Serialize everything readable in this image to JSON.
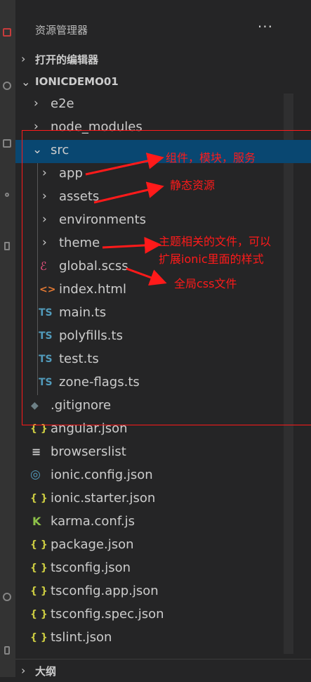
{
  "panel": {
    "title": "资源管理器",
    "more": "···"
  },
  "sections": {
    "open_editors": "打开的编辑器",
    "project": "IONICDEMO01",
    "outline": "大纲"
  },
  "tree": {
    "e2e": "e2e",
    "node_modules": "node_modules",
    "src": "src",
    "app": "app",
    "assets": "assets",
    "environments": "environments",
    "theme": "theme",
    "global_scss": "global.scss",
    "index_html": "index.html",
    "main_ts": "main.ts",
    "polyfills_ts": "polyfills.ts",
    "test_ts": "test.ts",
    "zone_flags_ts": "zone-flags.ts",
    "gitignore": ".gitignore",
    "angular_json": "angular.json",
    "browserslist": "browserslist",
    "ionic_config_json": "ionic.config.json",
    "ionic_starter_json": "ionic.starter.json",
    "karma_conf_js": "karma.conf.js",
    "package_json": "package.json",
    "tsconfig_json": "tsconfig.json",
    "tsconfig_app_json": "tsconfig.app.json",
    "tsconfig_spec_json": "tsconfig.spec.json",
    "tslint_json": "tslint.json"
  },
  "icons": {
    "ts": "TS",
    "json": "{ }",
    "html": "<>",
    "scss": "ℰ",
    "git": "◆",
    "list": "≡",
    "ionic": "◎",
    "karma": "K"
  },
  "annotations": {
    "app": "组件，模块，服务",
    "assets": "静态资源",
    "theme_line1": "主题相关的文件，可以",
    "theme_line2": "扩展ionic里面的样式",
    "global": "全局css文件"
  },
  "colors": {
    "background": "#252526",
    "selected": "#094771",
    "annotation": "#ff1a1a",
    "ts_icon": "#519aba",
    "json_icon": "#cbcb41",
    "html_icon": "#e37933",
    "scss_icon": "#f55385"
  }
}
